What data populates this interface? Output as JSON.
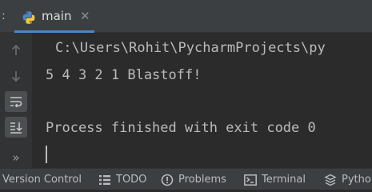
{
  "editor_tabs": {
    "lead_glyph": ":",
    "active_tab": {
      "label": "main",
      "icon": "python-file-icon",
      "close_glyph": "✕"
    }
  },
  "gutter": {
    "buttons": [
      {
        "name": "scroll-up-icon"
      },
      {
        "name": "scroll-down-icon"
      },
      {
        "name": "soft-wrap-icon"
      },
      {
        "name": "scroll-to-end-icon"
      },
      {
        "name": "more-icon",
        "glyph": "»"
      }
    ]
  },
  "console": {
    "lines": [
      "C:\\Users\\Rohit\\PycharmProjects\\py",
      "5 4 3 2 1 Blastoff!",
      "",
      "Process finished with exit code 0"
    ]
  },
  "tool_windows": [
    {
      "label": "Version Control",
      "icon": ""
    },
    {
      "label": "TODO",
      "icon": "todo-list-icon"
    },
    {
      "label": "Problems",
      "icon": "problems-icon"
    },
    {
      "label": "Terminal",
      "icon": "terminal-icon"
    },
    {
      "label": "Python",
      "icon": "python-console-icon"
    }
  ],
  "colors": {
    "background": "#2b2b2b",
    "panel": "#3c3f41",
    "text": "#bbbbbb",
    "accent": "#4a88c7"
  }
}
